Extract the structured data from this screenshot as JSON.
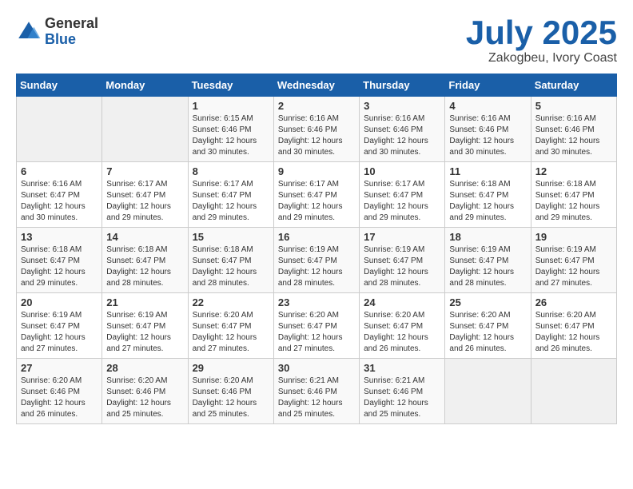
{
  "logo": {
    "general": "General",
    "blue": "Blue"
  },
  "header": {
    "month": "July 2025",
    "location": "Zakogbeu, Ivory Coast"
  },
  "days_of_week": [
    "Sunday",
    "Monday",
    "Tuesday",
    "Wednesday",
    "Thursday",
    "Friday",
    "Saturday"
  ],
  "weeks": [
    [
      {
        "num": "",
        "info": ""
      },
      {
        "num": "",
        "info": ""
      },
      {
        "num": "1",
        "info": "Sunrise: 6:15 AM\nSunset: 6:46 PM\nDaylight: 12 hours and 30 minutes."
      },
      {
        "num": "2",
        "info": "Sunrise: 6:16 AM\nSunset: 6:46 PM\nDaylight: 12 hours and 30 minutes."
      },
      {
        "num": "3",
        "info": "Sunrise: 6:16 AM\nSunset: 6:46 PM\nDaylight: 12 hours and 30 minutes."
      },
      {
        "num": "4",
        "info": "Sunrise: 6:16 AM\nSunset: 6:46 PM\nDaylight: 12 hours and 30 minutes."
      },
      {
        "num": "5",
        "info": "Sunrise: 6:16 AM\nSunset: 6:46 PM\nDaylight: 12 hours and 30 minutes."
      }
    ],
    [
      {
        "num": "6",
        "info": "Sunrise: 6:16 AM\nSunset: 6:47 PM\nDaylight: 12 hours and 30 minutes."
      },
      {
        "num": "7",
        "info": "Sunrise: 6:17 AM\nSunset: 6:47 PM\nDaylight: 12 hours and 29 minutes."
      },
      {
        "num": "8",
        "info": "Sunrise: 6:17 AM\nSunset: 6:47 PM\nDaylight: 12 hours and 29 minutes."
      },
      {
        "num": "9",
        "info": "Sunrise: 6:17 AM\nSunset: 6:47 PM\nDaylight: 12 hours and 29 minutes."
      },
      {
        "num": "10",
        "info": "Sunrise: 6:17 AM\nSunset: 6:47 PM\nDaylight: 12 hours and 29 minutes."
      },
      {
        "num": "11",
        "info": "Sunrise: 6:18 AM\nSunset: 6:47 PM\nDaylight: 12 hours and 29 minutes."
      },
      {
        "num": "12",
        "info": "Sunrise: 6:18 AM\nSunset: 6:47 PM\nDaylight: 12 hours and 29 minutes."
      }
    ],
    [
      {
        "num": "13",
        "info": "Sunrise: 6:18 AM\nSunset: 6:47 PM\nDaylight: 12 hours and 29 minutes."
      },
      {
        "num": "14",
        "info": "Sunrise: 6:18 AM\nSunset: 6:47 PM\nDaylight: 12 hours and 28 minutes."
      },
      {
        "num": "15",
        "info": "Sunrise: 6:18 AM\nSunset: 6:47 PM\nDaylight: 12 hours and 28 minutes."
      },
      {
        "num": "16",
        "info": "Sunrise: 6:19 AM\nSunset: 6:47 PM\nDaylight: 12 hours and 28 minutes."
      },
      {
        "num": "17",
        "info": "Sunrise: 6:19 AM\nSunset: 6:47 PM\nDaylight: 12 hours and 28 minutes."
      },
      {
        "num": "18",
        "info": "Sunrise: 6:19 AM\nSunset: 6:47 PM\nDaylight: 12 hours and 28 minutes."
      },
      {
        "num": "19",
        "info": "Sunrise: 6:19 AM\nSunset: 6:47 PM\nDaylight: 12 hours and 27 minutes."
      }
    ],
    [
      {
        "num": "20",
        "info": "Sunrise: 6:19 AM\nSunset: 6:47 PM\nDaylight: 12 hours and 27 minutes."
      },
      {
        "num": "21",
        "info": "Sunrise: 6:19 AM\nSunset: 6:47 PM\nDaylight: 12 hours and 27 minutes."
      },
      {
        "num": "22",
        "info": "Sunrise: 6:20 AM\nSunset: 6:47 PM\nDaylight: 12 hours and 27 minutes."
      },
      {
        "num": "23",
        "info": "Sunrise: 6:20 AM\nSunset: 6:47 PM\nDaylight: 12 hours and 27 minutes."
      },
      {
        "num": "24",
        "info": "Sunrise: 6:20 AM\nSunset: 6:47 PM\nDaylight: 12 hours and 26 minutes."
      },
      {
        "num": "25",
        "info": "Sunrise: 6:20 AM\nSunset: 6:47 PM\nDaylight: 12 hours and 26 minutes."
      },
      {
        "num": "26",
        "info": "Sunrise: 6:20 AM\nSunset: 6:47 PM\nDaylight: 12 hours and 26 minutes."
      }
    ],
    [
      {
        "num": "27",
        "info": "Sunrise: 6:20 AM\nSunset: 6:46 PM\nDaylight: 12 hours and 26 minutes."
      },
      {
        "num": "28",
        "info": "Sunrise: 6:20 AM\nSunset: 6:46 PM\nDaylight: 12 hours and 25 minutes."
      },
      {
        "num": "29",
        "info": "Sunrise: 6:20 AM\nSunset: 6:46 PM\nDaylight: 12 hours and 25 minutes."
      },
      {
        "num": "30",
        "info": "Sunrise: 6:21 AM\nSunset: 6:46 PM\nDaylight: 12 hours and 25 minutes."
      },
      {
        "num": "31",
        "info": "Sunrise: 6:21 AM\nSunset: 6:46 PM\nDaylight: 12 hours and 25 minutes."
      },
      {
        "num": "",
        "info": ""
      },
      {
        "num": "",
        "info": ""
      }
    ]
  ]
}
